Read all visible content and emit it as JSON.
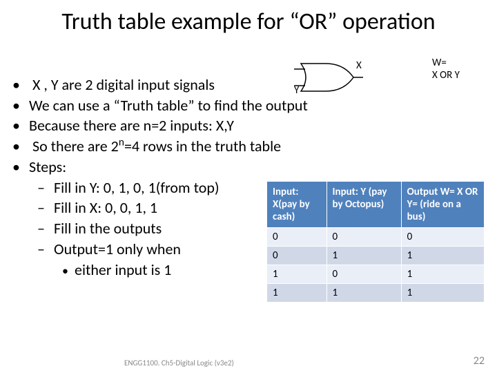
{
  "title": "Truth table example for “OR” operation",
  "gate": {
    "inX": "X",
    "inY": "Y",
    "out_line1": "W=",
    "out_line2": "X OR Y"
  },
  "bullets": {
    "0": " X ,  Y are 2 digital input signals",
    "1": "We can use a “Truth table” to find the output",
    "2": "Because there are n=2 inputs: X,Y",
    "3a": "So there are 2",
    "3sup": "n",
    "3b": "=4 rows in the  truth table",
    "4": "Steps:"
  },
  "sub": {
    "0": "Fill in Y: 0, 1, 0, 1(from top)",
    "1": "Fill in X: 0, 0, 1, 1",
    "2": "Fill in the outputs",
    "3": "Output=1 only when"
  },
  "subsub": {
    "0": "either input is 1"
  },
  "table": {
    "headers": [
      "Input:\nX(pay by cash)",
      "Input:\nY (pay by Octopus)",
      "Output\nW=\nX OR Y=\n(ride on a bus)"
    ],
    "rows": [
      [
        "0",
        "0",
        "0"
      ],
      [
        "0",
        "1",
        "1"
      ],
      [
        "1",
        "0",
        "1"
      ],
      [
        "1",
        "1",
        "1"
      ]
    ]
  },
  "footer": "ENGG1100. Ch5-Digital Logic (v3e2)",
  "page": "22",
  "chart_data": {
    "type": "table",
    "title": "OR truth table",
    "columns": [
      "X",
      "Y",
      "W = X OR Y"
    ],
    "rows": [
      [
        0,
        0,
        0
      ],
      [
        0,
        1,
        1
      ],
      [
        1,
        0,
        1
      ],
      [
        1,
        1,
        1
      ]
    ]
  }
}
